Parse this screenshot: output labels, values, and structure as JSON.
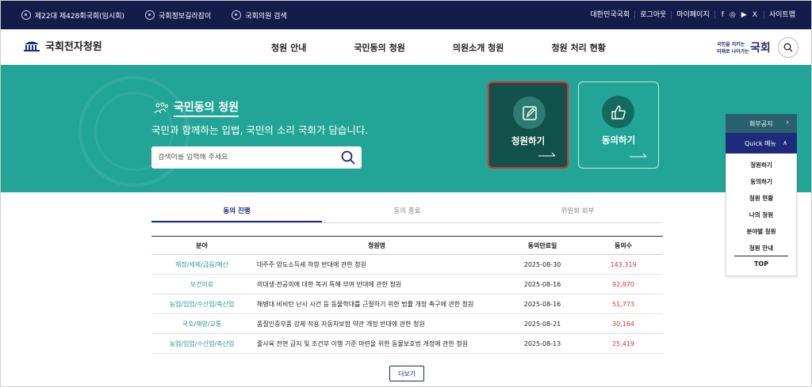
{
  "topbar": {
    "left": [
      "제22대 제428회국회(임시회)",
      "국회정보길라잡이",
      "국회의원 검색"
    ],
    "right": [
      "대한민국국회",
      "로그아웃",
      "마이페이지"
    ],
    "social": [
      "f",
      "◎",
      "▶",
      "X"
    ],
    "sitemap": "사이트맵"
  },
  "header": {
    "logo": "국회전자청원",
    "nav": [
      "청원 안내",
      "국민동의 청원",
      "의원소개 청원",
      "청원 처리 현황"
    ],
    "brand_line1": "국민을 지키는",
    "brand_line2": "미래로 나아가는",
    "brand_big": "국회"
  },
  "hero": {
    "title": "국민동의 청원",
    "subtitle": "국민과 함께하는 입법, 국민의 소리 국회가 담습니다.",
    "search_placeholder": "검색어를 입력해 주세요",
    "card1": "청원하기",
    "card2": "동의하기"
  },
  "tabs": [
    "동의 진행",
    "동의 종료",
    "위원회 회부"
  ],
  "table": {
    "headers": [
      "분야",
      "청원명",
      "동의만료일",
      "동의수"
    ],
    "rows": [
      {
        "field": "재정/세제/금융/예산",
        "title": "대주주 양도소득세 하향 반대에 관한 청원",
        "date": "2025-08-30",
        "count": "143,319"
      },
      {
        "field": "보건의료",
        "title": "의대생·전공의에 대한 복귀 특혜 부여 반대에 관한 청원",
        "date": "2025-08-16",
        "count": "92,870"
      },
      {
        "field": "농업/임업/수산업/축산업",
        "title": "해병대 비비탄 난사 사건 등 동물학대를 근절하기 위한 법률 개정 촉구에 관한 청원",
        "date": "2025-08-16",
        "count": "51,773"
      },
      {
        "field": "국토/해양/교통",
        "title": "품질인증부품 강제 적용 자동차보험 약관 개정 반대에 관한 청원",
        "date": "2025-08-21",
        "count": "30,164"
      },
      {
        "field": "농업/임업/수산업/축산업",
        "title": "줄사육 전면 금지 및 조건부 이행 기준 마련을 위한 동물보호법 개정에 관한 청원",
        "date": "2025-08-13",
        "count": "25,419"
      }
    ]
  },
  "more": "더보기",
  "side": {
    "notice": "회부공지",
    "quick": "Quick 메뉴",
    "items": [
      "청원하기",
      "동의하기",
      "청원 현황",
      "나의 청원",
      "분야별 청원",
      "청원 안내"
    ],
    "top": "TOP"
  }
}
